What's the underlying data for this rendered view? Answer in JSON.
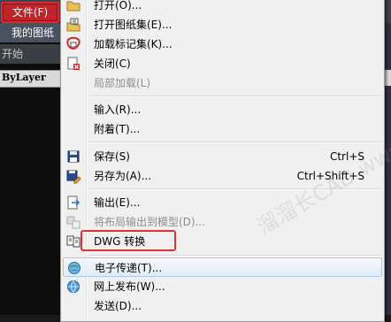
{
  "app": {
    "file_menu_label": "文件(F)",
    "ribbon_tab_label": "我的图纸",
    "start_tab_label": "开始",
    "layer_value": "ByLayer"
  },
  "menu": {
    "items": [
      {
        "label": "打开(O)...",
        "shortcut": "",
        "icon": "open-folder-icon",
        "disabled": false
      },
      {
        "label": "打开图纸集(E)...",
        "shortcut": "",
        "icon": "open-sheet-set-icon",
        "disabled": false
      },
      {
        "label": "加载标记集(K)...",
        "shortcut": "",
        "icon": "load-markup-icon",
        "disabled": false
      },
      {
        "label": "关闭(C)",
        "shortcut": "",
        "icon": "close-document-icon",
        "disabled": false
      },
      {
        "label": "局部加载(L)",
        "shortcut": "",
        "icon": "",
        "disabled": true
      },
      {
        "label": "输入(R)...",
        "shortcut": "",
        "icon": "",
        "disabled": false
      },
      {
        "label": "附着(T)...",
        "shortcut": "",
        "icon": "",
        "disabled": false
      },
      {
        "label": "保存(S)",
        "shortcut": "Ctrl+S",
        "icon": "save-icon",
        "disabled": false
      },
      {
        "label": "另存为(A)...",
        "shortcut": "Ctrl+Shift+S",
        "icon": "save-as-icon",
        "disabled": false
      },
      {
        "label": "输出(E)...",
        "shortcut": "",
        "icon": "export-icon",
        "disabled": false
      },
      {
        "label": "将布局输出到模型(D)...",
        "shortcut": "",
        "icon": "layout-to-model-icon",
        "disabled": true
      },
      {
        "label": "DWG 转换",
        "shortcut": "",
        "icon": "dwg-convert-icon",
        "disabled": false
      },
      {
        "label": "电子传递(T)...",
        "shortcut": "",
        "icon": "etransmit-icon",
        "disabled": false
      },
      {
        "label": "网上发布(W)...",
        "shortcut": "",
        "icon": "publish-web-icon",
        "disabled": false
      },
      {
        "label": "发送(D)...",
        "shortcut": "",
        "icon": "",
        "disabled": false
      }
    ]
  },
  "watermark": "溜溜长CAD  www.zzzcad.com",
  "colors": {
    "file_menu_bg": "#c1232a",
    "highlight_outline": "#e03434",
    "menu_bg": "#f0f0f0",
    "disabled_text": "#8d8d8d"
  }
}
